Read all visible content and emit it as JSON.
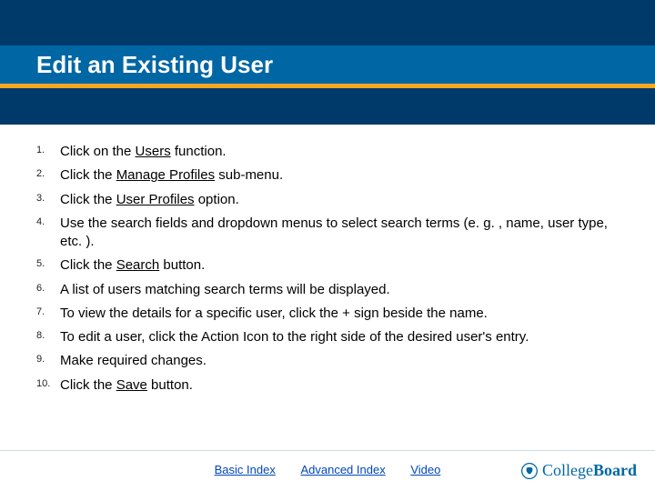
{
  "title": "Edit an Existing User",
  "steps": [
    {
      "pre": "Click on the ",
      "u": "Users",
      "post": " function."
    },
    {
      "pre": "Click the ",
      "u": "Manage Profiles",
      "post": " sub-menu."
    },
    {
      "pre": "Click the ",
      "u": "User Profiles",
      "post": " option."
    },
    {
      "pre": "Use the search fields and dropdown menus to select search terms (e. g. , name, user type, etc. ).",
      "u": "",
      "post": ""
    },
    {
      "pre": "Click the ",
      "u": "Search",
      "post": " button."
    },
    {
      "pre": "A list of users matching search terms will be displayed.",
      "u": "",
      "post": ""
    },
    {
      "pre": "To view the details for a specific user, click the + sign beside the name.",
      "u": "",
      "post": ""
    },
    {
      "pre": "To edit a user, click the Action Icon to the right side of the desired user's entry.",
      "u": "",
      "post": ""
    },
    {
      "pre": "Make required changes.",
      "u": "",
      "post": ""
    },
    {
      "pre": "Click the ",
      "u": "Save",
      "post": " button."
    }
  ],
  "links": {
    "basic": "Basic Index",
    "advanced": "Advanced Index",
    "video": "Video"
  },
  "brand": {
    "part1": "College",
    "part2": "Board"
  }
}
